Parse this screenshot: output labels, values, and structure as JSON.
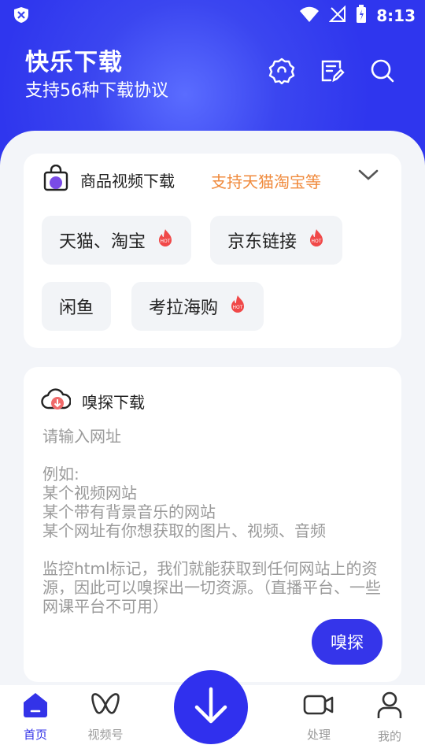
{
  "status_bar": {
    "time": "8:13"
  },
  "header": {
    "title": "快乐下载",
    "subtitle": "支持56种下载协议"
  },
  "product_card": {
    "title": "商品视频下载",
    "promo": "支持天猫淘宝等",
    "chips": [
      {
        "label": "天猫、淘宝",
        "hot": true,
        "hot_text": "HOT"
      },
      {
        "label": "京东链接",
        "hot": true,
        "hot_text": "HOT"
      },
      {
        "label": "闲鱼",
        "hot": false
      },
      {
        "label": "考拉海购",
        "hot": true,
        "hot_text": "HOT"
      }
    ]
  },
  "sniff_card": {
    "title": "嗅探下载",
    "placeholder": "请输入网址\n\n例如:\n某个视频网站\n某个带有背景音乐的网站\n某个网址有你想获取的图片、视频、音频\n\n监控html标记，我们就能获取到任何网站上的资源，因此可以嗅探出一切资源。（直播平台、一些网课平台不可用）",
    "button": "嗅探"
  },
  "tabs": [
    {
      "label": "首页",
      "icon": "home-icon",
      "active": true
    },
    {
      "label": "视频号",
      "icon": "channels-icon",
      "active": false
    },
    {
      "label": "处理",
      "icon": "video-camera-icon",
      "active": false
    },
    {
      "label": "我的",
      "icon": "user-icon",
      "active": false
    }
  ],
  "colors": {
    "primary": "#3030ee",
    "promo": "#f08a3c",
    "hot": "#f04848"
  }
}
